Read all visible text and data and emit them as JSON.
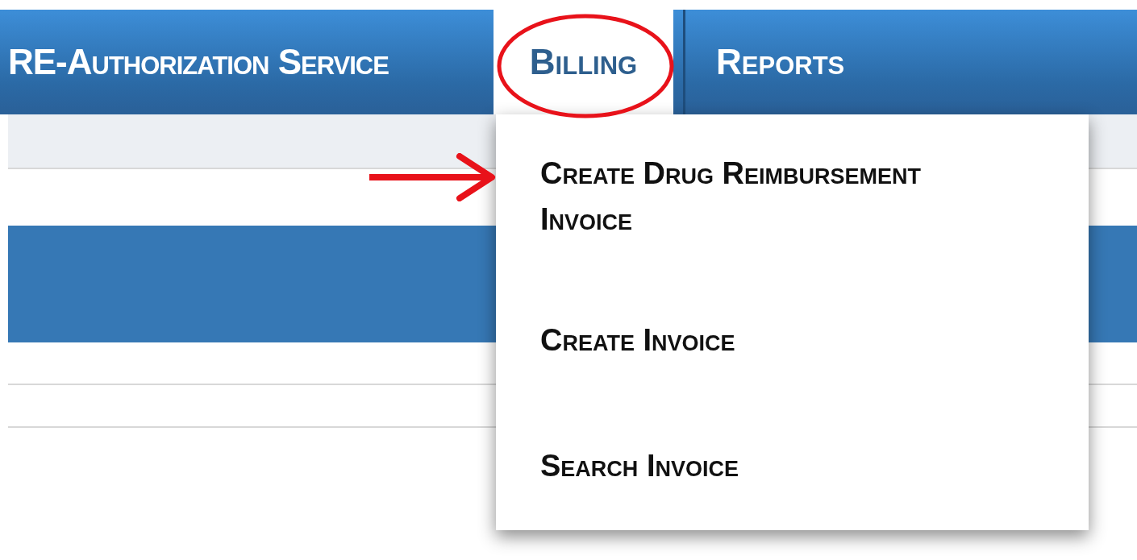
{
  "nav": {
    "items": [
      {
        "label": "RE-Authorization Service",
        "selected": false
      },
      {
        "label": "Billing",
        "selected": true
      },
      {
        "label": "Reports",
        "selected": false
      }
    ]
  },
  "dropdown": {
    "items": [
      {
        "label": "Create Drug Reimbursement Invoice"
      },
      {
        "label": "Create Invoice"
      },
      {
        "label": "Search Invoice"
      }
    ]
  },
  "highlight": {
    "color": "#e8121a"
  },
  "pointer": {
    "color": "#e8121a"
  }
}
